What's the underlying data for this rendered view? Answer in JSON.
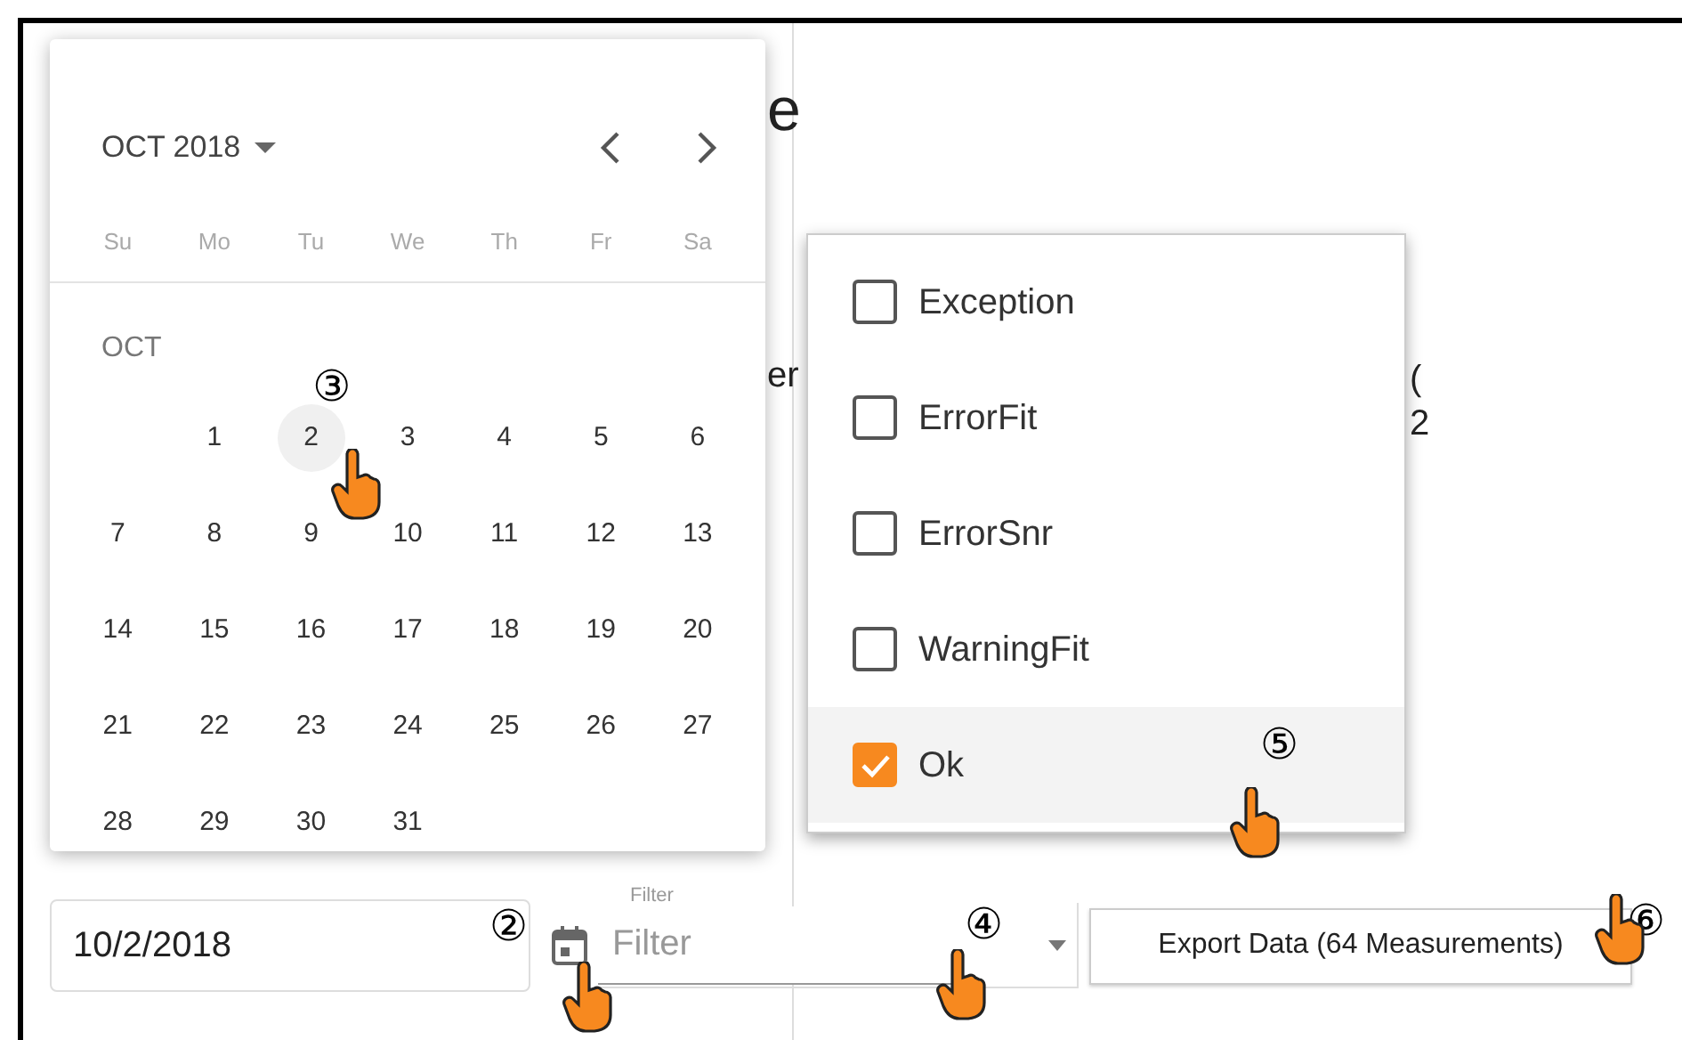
{
  "background": {
    "heading_fragment": "e",
    "label_fragment": "er",
    "right_fragments": [
      "(",
      "2"
    ],
    "filter_label": "Filter"
  },
  "date_picker": {
    "month_label": "OCT 2018",
    "weekdays": [
      "Su",
      "Mo",
      "Tu",
      "We",
      "Th",
      "Fr",
      "Sa"
    ],
    "section_label": "OCT",
    "weeks": [
      [
        {
          "kind": "blank"
        },
        {
          "kind": "day",
          "label": "1",
          "hovered": false
        },
        {
          "kind": "day",
          "label": "2",
          "hovered": true,
          "callout": "③"
        },
        {
          "kind": "day",
          "label": "3",
          "hovered": false
        },
        {
          "kind": "day",
          "label": "4",
          "hovered": false
        },
        {
          "kind": "day",
          "label": "5",
          "hovered": false
        },
        {
          "kind": "day",
          "label": "6",
          "hovered": false
        }
      ],
      [
        {
          "kind": "day",
          "label": "7",
          "hovered": false
        },
        {
          "kind": "day",
          "label": "8",
          "hovered": false
        },
        {
          "kind": "day",
          "label": "9",
          "hovered": false
        },
        {
          "kind": "day",
          "label": "10",
          "hovered": false
        },
        {
          "kind": "day",
          "label": "11",
          "hovered": false
        },
        {
          "kind": "day",
          "label": "12",
          "hovered": false
        },
        {
          "kind": "day",
          "label": "13",
          "hovered": false
        }
      ],
      [
        {
          "kind": "day",
          "label": "14",
          "hovered": false
        },
        {
          "kind": "day",
          "label": "15",
          "hovered": false
        },
        {
          "kind": "day",
          "label": "16",
          "hovered": false
        },
        {
          "kind": "day",
          "label": "17",
          "hovered": false
        },
        {
          "kind": "day",
          "label": "18",
          "hovered": false
        },
        {
          "kind": "day",
          "label": "19",
          "hovered": false
        },
        {
          "kind": "day",
          "label": "20",
          "hovered": false
        }
      ],
      [
        {
          "kind": "day",
          "label": "21",
          "hovered": false
        },
        {
          "kind": "day",
          "label": "22",
          "hovered": false
        },
        {
          "kind": "day",
          "label": "23",
          "hovered": false
        },
        {
          "kind": "day",
          "label": "24",
          "hovered": false
        },
        {
          "kind": "day",
          "label": "25",
          "hovered": false
        },
        {
          "kind": "day",
          "label": "26",
          "hovered": false
        },
        {
          "kind": "day",
          "label": "27",
          "hovered": false
        }
      ],
      [
        {
          "kind": "day",
          "label": "28",
          "hovered": false
        },
        {
          "kind": "day",
          "label": "29",
          "hovered": false
        },
        {
          "kind": "day",
          "label": "30",
          "hovered": false
        },
        {
          "kind": "day",
          "label": "31",
          "hovered": false
        }
      ]
    ]
  },
  "status_menu": {
    "items": [
      {
        "label": "Exception",
        "checked": false,
        "hovered": false
      },
      {
        "label": "ErrorFit",
        "checked": false,
        "hovered": false
      },
      {
        "label": "ErrorSnr",
        "checked": false,
        "hovered": false
      },
      {
        "label": "WarningFit",
        "checked": false,
        "hovered": false
      },
      {
        "label": "Ok",
        "checked": true,
        "hovered": true,
        "callout": "⑤"
      }
    ]
  },
  "date_field": {
    "value": "10/2/2018",
    "callout": "②"
  },
  "filter_field": {
    "placeholder": "Filter",
    "callout": "④"
  },
  "export_button": {
    "label": "Export Data (64 Measurements)",
    "callout": "⑥"
  }
}
